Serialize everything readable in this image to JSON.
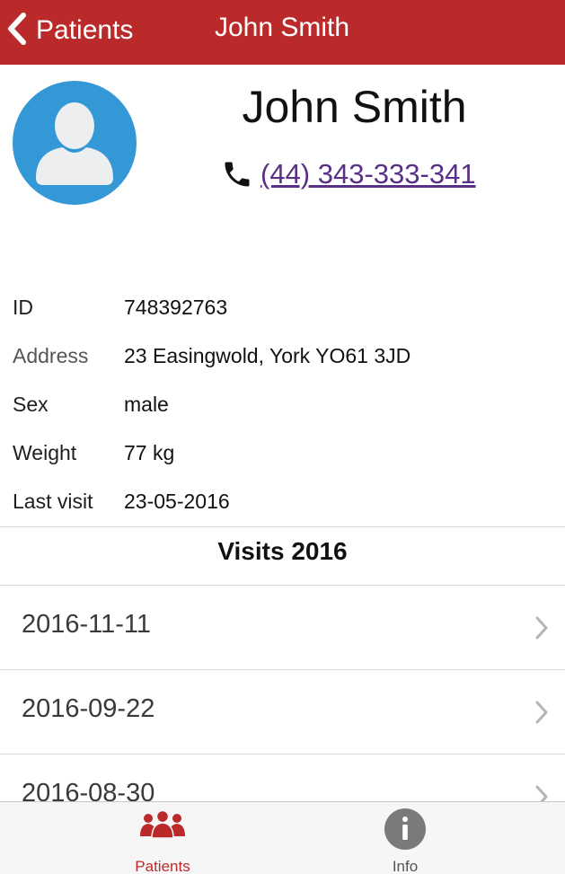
{
  "header": {
    "back_label": "Patients",
    "title": "John Smith",
    "bg_color": "#bb2a2a"
  },
  "profile": {
    "name": "John Smith",
    "phone": "(44) 343-333-341",
    "avatar_icon": "user-silhouette-icon",
    "avatar_color": "#3598d6"
  },
  "details": [
    {
      "label": "ID",
      "value": "748392763"
    },
    {
      "label": "Address",
      "value": "23 Easingwold, York YO61 3JD"
    },
    {
      "label": "Sex",
      "value": "male"
    },
    {
      "label": "Weight",
      "value": "77 kg"
    },
    {
      "label": "Last visit",
      "value": "23-05-2016"
    }
  ],
  "visits": {
    "title": "Visits 2016",
    "items": [
      {
        "date": "2016-11-11"
      },
      {
        "date": "2016-09-22"
      },
      {
        "date": "2016-08-30"
      }
    ]
  },
  "tabbar": {
    "patients_label": "Patients",
    "info_label": "Info",
    "active_color": "#bb2a2a"
  }
}
